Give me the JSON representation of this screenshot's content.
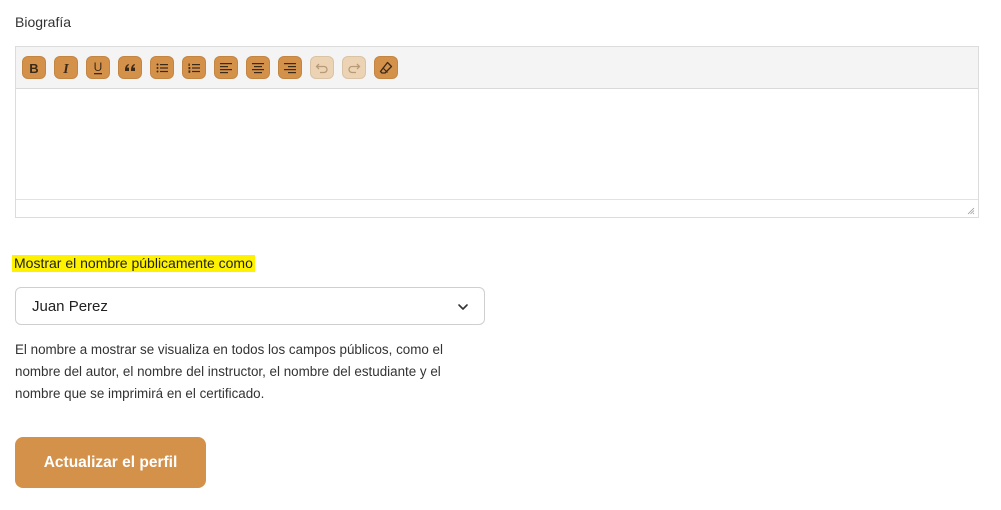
{
  "bio": {
    "label": "Biografía"
  },
  "toolbar": {
    "buttons": [
      {
        "icon": "bold-icon",
        "glyph": "B"
      },
      {
        "icon": "italic-icon",
        "glyph": "I"
      },
      {
        "icon": "underline-icon",
        "glyph": "U"
      },
      {
        "icon": "blockquote-icon"
      },
      {
        "icon": "bullet-list-icon"
      },
      {
        "icon": "numbered-list-icon"
      },
      {
        "icon": "align-left-icon"
      },
      {
        "icon": "align-center-icon"
      },
      {
        "icon": "align-right-icon"
      },
      {
        "icon": "undo-icon",
        "disabled": true
      },
      {
        "icon": "redo-icon",
        "disabled": true
      },
      {
        "icon": "eraser-icon"
      }
    ]
  },
  "display_name": {
    "label": "Mostrar el nombre públicamente como",
    "selected": "Juan Perez",
    "help": "El nombre a mostrar se visualiza en todos los campos públicos, como el nombre del autor, el nombre del instructor, el nombre del estudiante y el nombre que se imprimirá en el certificado."
  },
  "submit": {
    "label": "Actualizar el perfil"
  },
  "colors": {
    "accent": "#d4914a",
    "accent_disabled": "#ecd3b3",
    "highlight": "#fff200"
  }
}
